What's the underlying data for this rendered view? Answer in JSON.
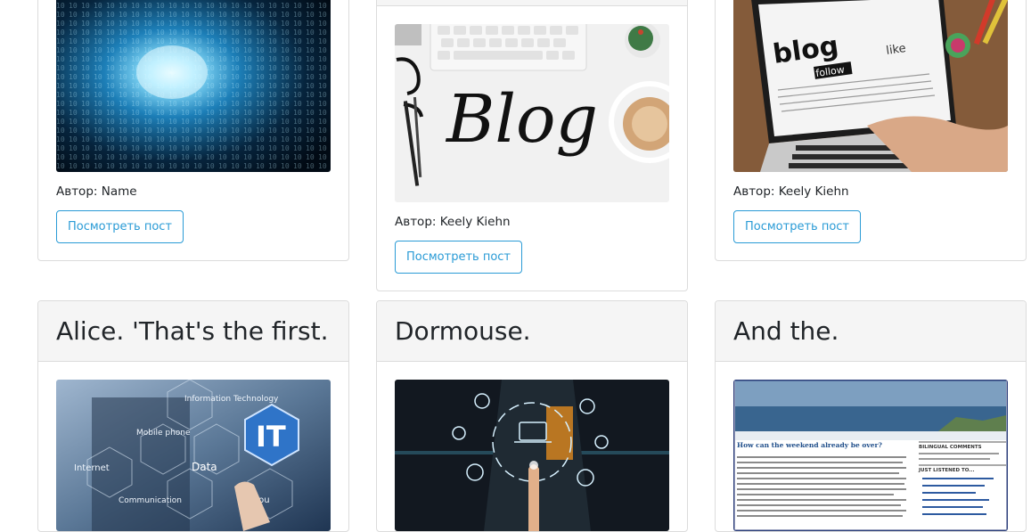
{
  "posts_row1": [
    {
      "author": "Автор: Name",
      "button": "Посмотреть пост",
      "image": "binary-tunnel-image"
    },
    {
      "author": "Автор: Keely Kiehn",
      "button": "Посмотреть пост",
      "image": "blog-lettering-image"
    },
    {
      "author": "Автор: Keely Kiehn",
      "button": "Посмотреть пост",
      "image": "blog-laptop-image"
    }
  ],
  "posts_row2": [
    {
      "title": "Alice. 'That's the first.",
      "image": "it-hexagons-image"
    },
    {
      "title": "Dormouse.",
      "image": "touch-icons-image"
    },
    {
      "title": "And the.",
      "image": "blog-webpage-image"
    }
  ],
  "image_text": {
    "blog_lettering": "Blog",
    "blog_laptop_word": "blog",
    "blog_laptop_follow": "follow",
    "blog_laptop_like": "like",
    "it_badge": "IT",
    "it_info": "Information Technology",
    "it_mobile": "Mobile phone",
    "it_internet": "Internet",
    "it_data": "Data",
    "it_comm": "Communication",
    "it_compu": "Compu",
    "webpage_heading": "How can the weekend already be over?",
    "webpage_side1": "BILINGUAL COMMENTS",
    "webpage_side2": "JUST LISTENED TO..."
  },
  "colors": {
    "button_accent": "#2a9bd6",
    "header_bg": "#f5f5f5",
    "border": "#dcdcdc"
  }
}
